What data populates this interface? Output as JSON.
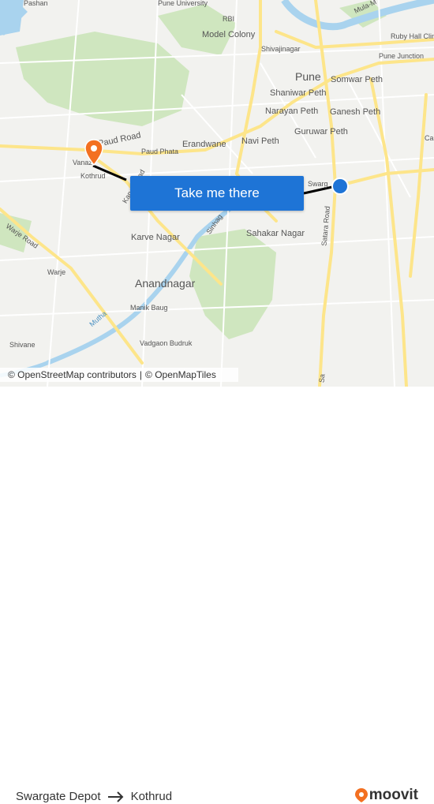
{
  "map": {
    "labels": {
      "pashan": "Pashan",
      "pune_university": "Pune University",
      "rbi": "RBI",
      "model_colony": "Model Colony",
      "shivajinagar": "Shivajinagar",
      "mula_mutha": "Mula-M",
      "ruby_hall": "Ruby Hall Clin",
      "pune_junction": "Pune Junction",
      "pune": "Pune",
      "somwar_peth": "Somwar Peth",
      "shaniwar_peth": "Shaniwar Peth",
      "narayan_peth": "Narayan Peth",
      "ganesh_peth": "Ganesh Peth",
      "guruwar_peth": "Guruwar Peth",
      "navi_peth": "Navi Peth",
      "erandwane": "Erandwane",
      "paud_road": "Paud Road",
      "paud_phata": "Paud Phata",
      "vanaz": "Vanaz",
      "kothrud": "Kothrud",
      "karve_road": "Karve Road",
      "swargate_partial": "Swarg",
      "ca_partial": "Ca",
      "satara_road": "Satara Road",
      "sinhagad": "Sinhag",
      "sahakar_nagar": "Sahakar Nagar",
      "karve_nagar": "Karve Nagar",
      "warje_road": "Warje Road",
      "warje": "Warje",
      "anandnagar": "Anandnagar",
      "manik_baug": "Manik Baug",
      "mutha": "Mutha",
      "shivane": "Shivane",
      "vadgaon_budruk": "Vadgaon Budruk",
      "satara_road_bottom": "Sa"
    },
    "colors": {
      "route": "#000000",
      "origin": "#1e74d6",
      "destination": "#f37021",
      "water": "#a9d3ee",
      "park": "#cfe6bf",
      "road_major": "#fde58a"
    },
    "icons": {
      "origin": "circle-origin-marker",
      "destination": "map-pin-marker"
    }
  },
  "cta": {
    "label": "Take me there"
  },
  "attribution": {
    "osm": "© OpenStreetMap contributors",
    "sep": "|",
    "omt": "© OpenMapTiles"
  },
  "footer": {
    "origin": "Swargate Depot",
    "destination": "Kothrud",
    "logo_text": "moovit"
  }
}
